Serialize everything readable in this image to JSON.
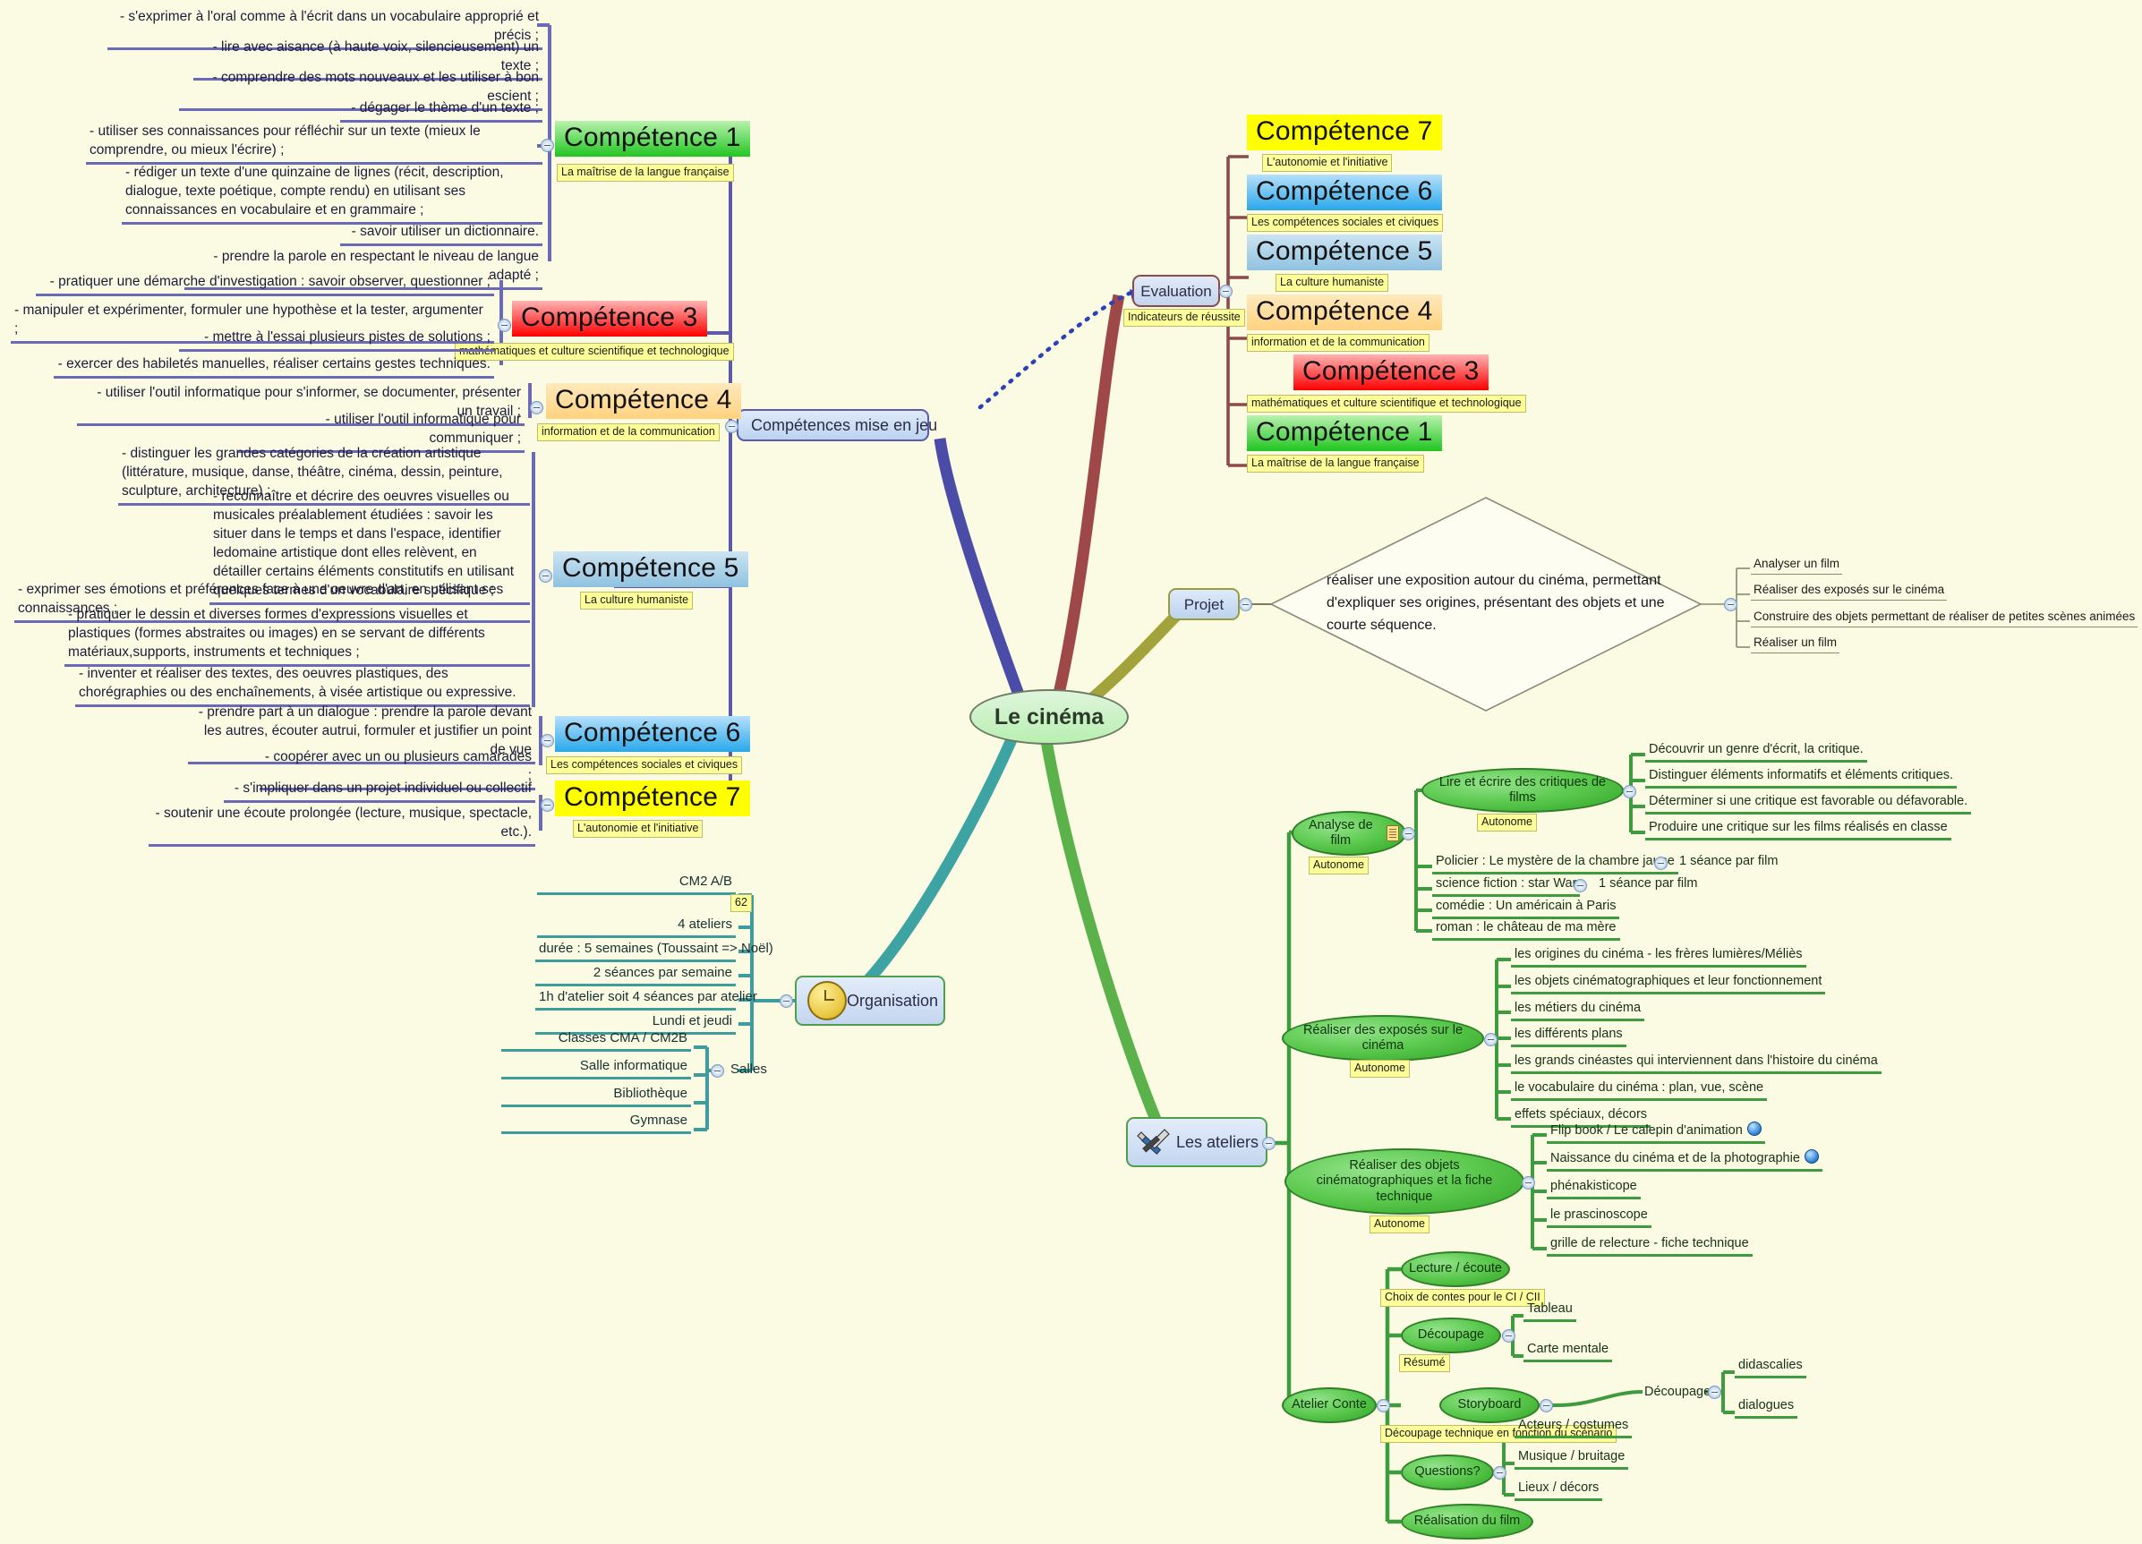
{
  "root": {
    "label": "Le cinéma"
  },
  "branches": {
    "competences": {
      "label": "Compétences mise en jeu",
      "evaluation": {
        "label": "Evaluation",
        "caption": "Indicateurs de réussite"
      }
    },
    "projet": {
      "label": "Projet"
    },
    "organisation": {
      "label": "Organisation",
      "icon": "clock-icon"
    },
    "ateliers": {
      "label": "Les ateliers",
      "icon": "tools-icon"
    }
  },
  "competence_titles": {
    "c1": {
      "title": "Compétence 1",
      "caption": "La maîtrise de la langue française",
      "color": "#21c521"
    },
    "c3": {
      "title": "Compétence 3",
      "caption": "mathématiques et  culture scientifique et technologique",
      "color": "#fe0000"
    },
    "c4": {
      "title": "Compétence 4",
      "caption": "information et de la communication",
      "color": "#ffd27f"
    },
    "c5": {
      "title": "Compétence 5",
      "caption": "La culture humaniste",
      "color": "#8fc2e0"
    },
    "c6": {
      "title": "Compétence 6",
      "caption": "Les compétences sociales et civiques",
      "color": "#29a8ea"
    },
    "c7": {
      "title": "Compétence 7",
      "caption": "L'autonomie et l'initiative",
      "color": "#ffff00"
    }
  },
  "comp1_items": [
    "- s'exprimer à l'oral comme à l'écrit dans un vocabulaire approprié et précis ;",
    "- lire avec aisance (à haute voix, silencieusement) un texte ;",
    "- comprendre des mots nouveaux et les utiliser à bon escient ;",
    "- dégager le thème d'un texte ;",
    "- utiliser ses connaissances pour réfléchir sur un texte (mieux le comprendre, ou mieux l'écrire) ;",
    "- rédiger un texte d'une quinzaine de lignes (récit, description, dialogue, texte poétique, compte rendu) en utilisant ses connaissances en vocabulaire et en grammaire ;",
    "- savoir utiliser un dictionnaire.",
    "- prendre la parole en respectant le niveau de langue adapté ;"
  ],
  "comp3_items": [
    "- pratiquer une démarche d'investigation : savoir observer, questionner ;",
    "- manipuler et expérimenter, formuler une hypothèse et la tester, argumenter ;",
    "- mettre à l'essai plusieurs pistes de solutions ;",
    "- exercer des habiletés manuelles, réaliser certains gestes techniques."
  ],
  "comp4_items": [
    "- utiliser l'outil informatique pour s'informer, se documenter, présenter un travail ;",
    "- utiliser l'outil informatique pour communiquer ;"
  ],
  "comp5_items": [
    "- distinguer les grandes catégories de la création artistique (littérature, musique, danse, théâtre, cinéma, dessin, peinture, sculpture, architecture) ;",
    "- reconnaître et décrire des oeuvres visuelles ou musicales préalablement étudiées : savoir les situer dans le temps et dans l'espace, identifier ledomaine artistique dont elles relèvent, en détailler certains éléments constitutifs en utilisant quelques termes d'un vocabulaire spécifique ;",
    "- exprimer ses émotions et préférences face à une oeuvre d'art, en utilisant ses connaissances ;",
    "- pratiquer le dessin et diverses formes d'expressions visuelles et plastiques (formes abstraites ou images) en se servant de différents matériaux,supports, instruments et techniques ;",
    "- inventer et réaliser des textes, des oeuvres plastiques, des chorégraphies ou des enchaînements, à visée artistique ou expressive."
  ],
  "comp6_items": [
    "- prendre part à un dialogue : prendre la parole devant les autres, écouter autrui, formuler et justifier un point de vue",
    "- coopérer avec un ou plusieurs camarades ;"
  ],
  "comp7_items": [
    "- s'impliquer dans un projet individuel ou collectif",
    "- soutenir une écoute prolongée (lecture, musique, spectacle, etc.)."
  ],
  "projet": {
    "description": "réaliser une exposition autour du cinéma, permettant d'expliquer ses origines, présentant des objets et une courte séquence.",
    "outcomes": [
      "Analyser un film",
      "Réaliser des exposés sur le cinéma",
      "Construire des objets permettant de réaliser de petites scènes animées",
      "Réaliser un film"
    ]
  },
  "organisation": {
    "items": [
      {
        "label": "CM2 A/B",
        "chip": "62"
      },
      {
        "label": "4 ateliers"
      },
      {
        "label": "durée : 5 semaines (Toussaint => Noël)"
      },
      {
        "label": "2 séances par semaine"
      },
      {
        "label": "1h d'atelier soit 4 séances par atelier"
      },
      {
        "label": "Lundi et jeudi"
      }
    ],
    "salles": {
      "label": "Salles",
      "items": [
        "Classes CMA / CM2B",
        "Salle informatique",
        "Bibliothèque",
        "Gymnase"
      ]
    }
  },
  "ateliers": {
    "analyse_de_film": {
      "label": "Analyse de film",
      "tag": "Autonome",
      "critiques": {
        "label": "Lire et écrire des critiques de films",
        "tag": "Autonome",
        "items": [
          "Découvrir un genre d'écrit, la critique.",
          "Distinguer éléments informatifs et éléments critiques.",
          "Déterminer si une critique est favorable ou défavorable.",
          "Produire une critique sur les films réalisés en classe"
        ]
      },
      "films": [
        {
          "label": "Policier : Le mystère de la chambre jaune",
          "note": "1 séance par film"
        },
        {
          "label": "science fiction : star War",
          "note": "1 séance par film"
        },
        {
          "label": "comédie : Un américain à Paris",
          "note": ""
        },
        {
          "label": "roman : le château de ma mère",
          "note": ""
        }
      ]
    },
    "exposes": {
      "label": "Réaliser des exposés sur le cinéma",
      "tag": "Autonome",
      "items": [
        "les origines du cinéma - les frères lumières/Méliès",
        "les objets cinématographiques et leur fonctionnement",
        "les métiers du cinéma",
        "les différents plans",
        "les grands cinéastes qui interviennent dans l'histoire du cinéma",
        "le vocabulaire du cinéma : plan, vue, scène",
        "effets spéciaux, décors"
      ]
    },
    "objets": {
      "label": "Réaliser des objets cinématographiques et la fiche technique",
      "tag": "Autonome",
      "items": [
        {
          "label": "Flip book / Le calepin d'animation",
          "globe": true
        },
        {
          "label": "Naissance du cinéma et de la photographie",
          "globe": true
        },
        {
          "label": "phénakisticope",
          "globe": false
        },
        {
          "label": "le prascinoscope",
          "globe": false
        },
        {
          "label": "grille de relecture - fiche technique",
          "globe": false
        }
      ]
    },
    "atelier_conte": {
      "label": "Atelier Conte",
      "lecture": {
        "label": "Lecture / écoute",
        "chip": "Choix de contes pour le CI / CII"
      },
      "decoupage": {
        "label": "Découpage",
        "chip": "Résumé",
        "items": [
          "Tableau",
          "Carte mentale"
        ]
      },
      "storyboard": {
        "label": "Storyboard",
        "chip": "Découpage technique en fonction du scénario",
        "sub": {
          "label": "Découpage",
          "items": [
            "didascalies",
            "dialogues"
          ]
        }
      },
      "questions": {
        "label": "Questions?",
        "items": [
          "Acteurs / costumes",
          "Musique / bruitage",
          "Lieux / décors"
        ]
      },
      "realisation": {
        "label": "Réalisation du film"
      }
    }
  }
}
